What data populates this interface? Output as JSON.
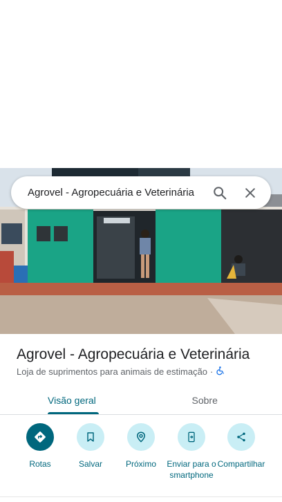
{
  "search": {
    "query": "Agrovel - Agropecuária e Veterinária"
  },
  "place": {
    "title": "Agrovel - Agropecuária e Veterinária",
    "category": "Loja de suprimentos para animais de estimação",
    "separator": "·"
  },
  "tabs": [
    {
      "label": "Visão geral",
      "active": true
    },
    {
      "label": "Sobre",
      "active": false
    }
  ],
  "actions": [
    {
      "label": "Rotas",
      "icon": "directions-icon"
    },
    {
      "label": "Salvar",
      "icon": "bookmark-icon"
    },
    {
      "label": "Próximo",
      "icon": "nearby-icon"
    },
    {
      "label": "Enviar para o smartphone",
      "icon": "send-to-phone-icon"
    },
    {
      "label": "Compartilhar",
      "icon": "share-icon"
    }
  ],
  "colors": {
    "accent": "#00677d",
    "accent_light": "#c9eef5",
    "storefront_green": "#1aa486"
  }
}
